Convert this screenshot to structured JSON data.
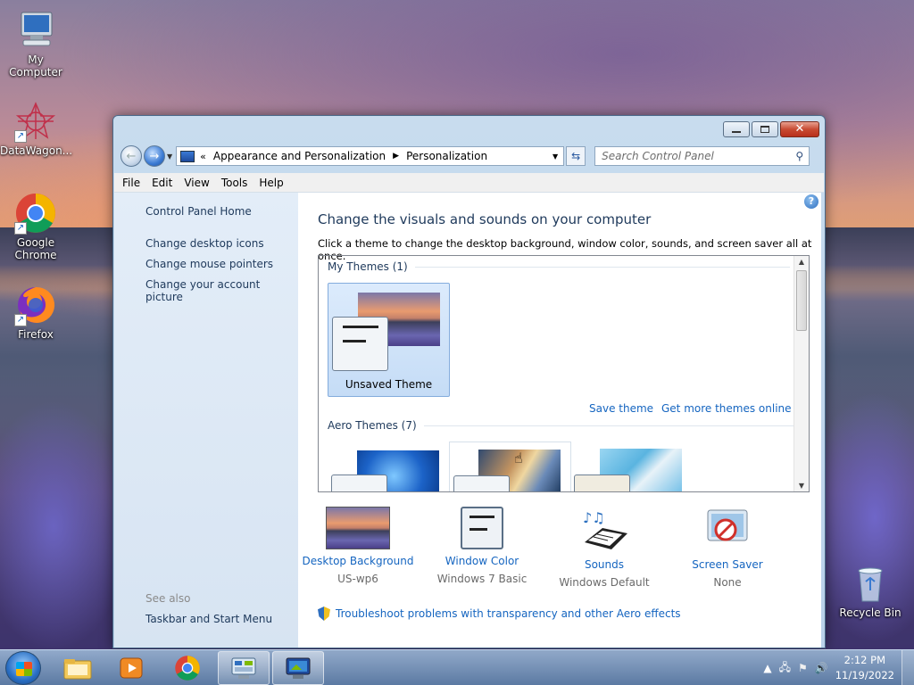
{
  "desktop": {
    "icons": [
      {
        "label": "My Computer"
      },
      {
        "label": "DataWagon..."
      },
      {
        "label": "Google Chrome"
      },
      {
        "label": "Firefox"
      },
      {
        "label": "Recycle Bin"
      }
    ]
  },
  "window": {
    "nav": {
      "breadcrumb": [
        "Appearance and Personalization",
        "Personalization"
      ],
      "search_placeholder": "Search Control Panel"
    },
    "menu": [
      "File",
      "Edit",
      "View",
      "Tools",
      "Help"
    ],
    "left_pane": {
      "home": "Control Panel Home",
      "links": [
        "Change desktop icons",
        "Change mouse pointers",
        "Change your account picture"
      ],
      "see_also": "See also",
      "see_also_links": [
        "Taskbar and Start Menu"
      ]
    },
    "content": {
      "heading": "Change the visuals and sounds on your computer",
      "subtext": "Click a theme to change the desktop background, window color, sounds, and screen saver all at once.",
      "my_themes_header": "My Themes (1)",
      "selected_theme": "Unsaved Theme",
      "save_theme": "Save theme",
      "get_more": "Get more themes online",
      "aero_header": "Aero Themes (7)",
      "bottom_items": [
        {
          "title": "Desktop Background",
          "value": "US-wp6",
          "icon": "desktop-background-icon"
        },
        {
          "title": "Window Color",
          "value": "Windows 7 Basic",
          "icon": "window-color-icon"
        },
        {
          "title": "Sounds",
          "value": "Windows Default",
          "icon": "sounds-icon"
        },
        {
          "title": "Screen Saver",
          "value": "None",
          "icon": "screen-saver-icon"
        }
      ],
      "troubleshoot": "Troubleshoot problems with transparency and other Aero effects"
    }
  },
  "taskbar": {
    "time": "2:12 PM",
    "date": "11/19/2022"
  },
  "colors": {
    "link": "#1565c0",
    "heading": "#1e395b",
    "close_button": "#c84b32",
    "left_pane": "#dfeaf6"
  }
}
